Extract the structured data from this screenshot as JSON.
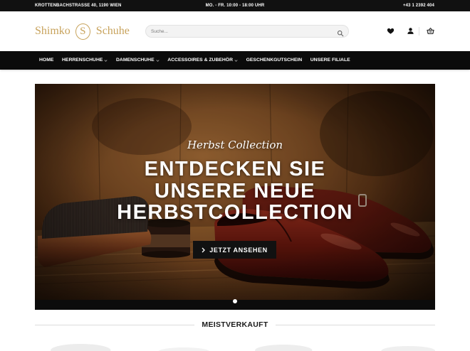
{
  "colors": {
    "accent": "#c8a35c",
    "topbar_background": "#111111",
    "nav_background": "#0b0b0b",
    "button_background": "#111111",
    "heading_text": "#1a1a1a"
  },
  "topbar": {
    "address": "KROTTENBACHSTRASSE 40, 1190 WIEN",
    "opening_hours": "MO. - FR. 10:00 - 18:00 UHR",
    "phone": "+43 1 2392 404"
  },
  "logo": {
    "word_left": "Shimko",
    "emblem_letter": "S",
    "word_right": "Schuhe"
  },
  "search": {
    "placeholder": "Suche...",
    "value": "",
    "icon": "search-icon"
  },
  "header_icons": [
    "heart-icon",
    "user-icon",
    "basket-icon"
  ],
  "nav": {
    "items": [
      {
        "label": "HOME",
        "has_dropdown": false
      },
      {
        "label": "HERRENSCHUHE",
        "has_dropdown": true
      },
      {
        "label": "DAMENSCHUHE",
        "has_dropdown": true
      },
      {
        "label": "ACCESSOIRES & ZUBEHÖR",
        "has_dropdown": true
      },
      {
        "label": "GESCHENKGUTSCHEIN",
        "has_dropdown": false
      },
      {
        "label": "UNSERE FILIALE",
        "has_dropdown": false
      }
    ]
  },
  "hero": {
    "subtitle": "Herbst Collection",
    "title_lines": [
      "ENTDECKEN SIE",
      "UNSERE NEUE",
      "HERBSTCOLLECTION"
    ],
    "button": {
      "label": "JETZT ANSEHEN",
      "icon": "chevron-right-icon"
    },
    "slider": {
      "dot_count": 1,
      "active_index": 0
    }
  },
  "sections": {
    "bestsellers_title": "MEISTVERKAUFT"
  }
}
